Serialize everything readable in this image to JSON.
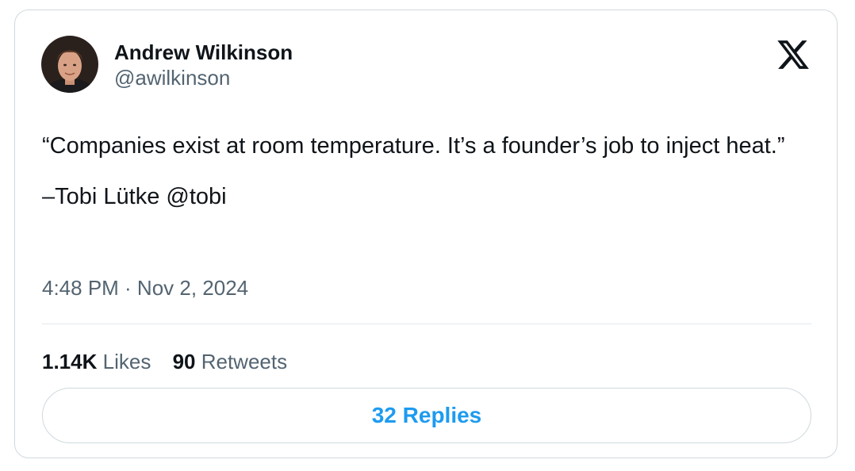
{
  "tweet": {
    "author": {
      "name": "Andrew Wilkinson",
      "handle": "@awilkinson",
      "avatar_icon": "profile-photo"
    },
    "brand_icon": "x-logo-icon",
    "text": "“Companies exist at room temperature. It’s a founder’s job to inject heat.”",
    "attribution": "–Tobi Lütke @tobi",
    "timestamp": "4:48 PM · Nov 2, 2024",
    "stats": {
      "likes_count": "1.14K",
      "likes_label": "Likes",
      "retweets_count": "90",
      "retweets_label": "Retweets"
    },
    "replies_button_label": "32 Replies"
  },
  "colors": {
    "text_primary": "#0f1419",
    "text_secondary": "#536471",
    "accent": "#1d9bf0",
    "border": "#cfd9de"
  }
}
